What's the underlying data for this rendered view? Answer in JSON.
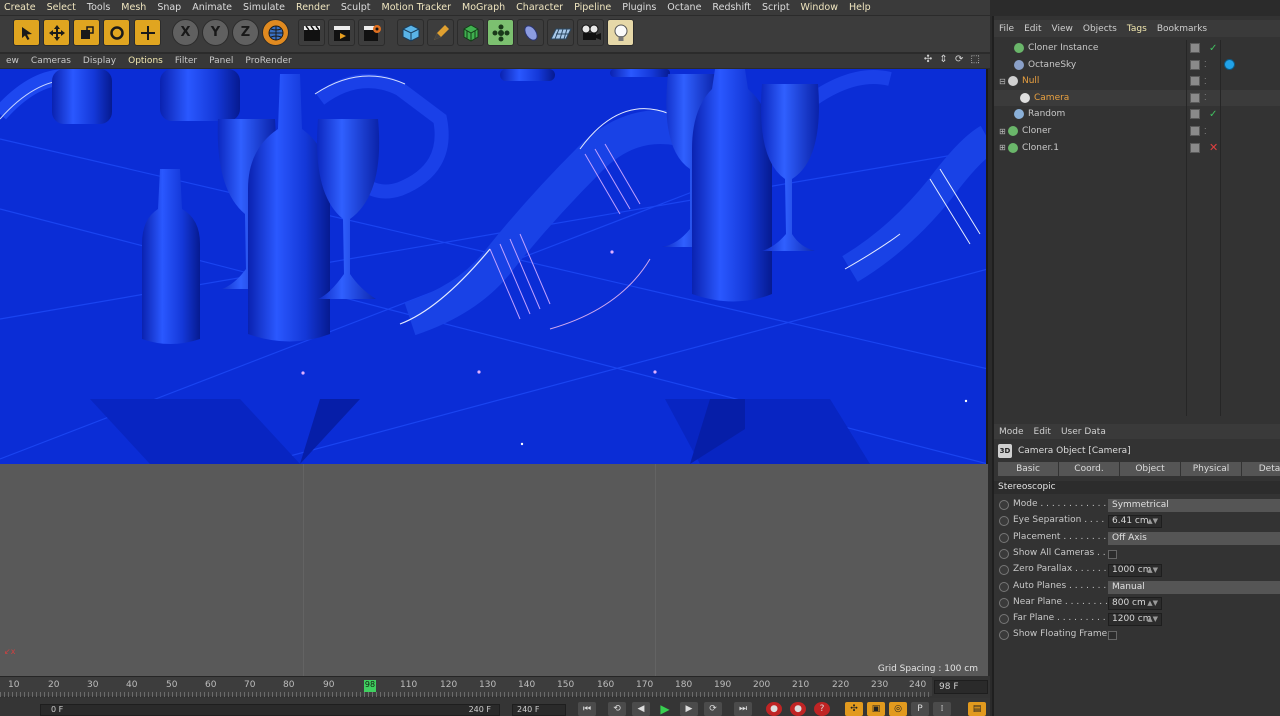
{
  "menubar": {
    "items": [
      "Create",
      "Select",
      "Tools",
      "Mesh",
      "Snap",
      "Animate",
      "Simulate",
      "Render",
      "Sculpt",
      "Motion Tracker",
      "MoGraph",
      "Character",
      "Pipeline",
      "Plugins",
      "Octane",
      "Redshift",
      "Script",
      "Window",
      "Help"
    ]
  },
  "toolbar": {
    "buttons": [
      "select-cursor",
      "move",
      "scale",
      "rotate",
      "recent-add",
      "x-axis",
      "y-axis",
      "z-axis",
      "world-coordinates",
      "render-view",
      "render-picture-viewer",
      "render-settings",
      "cube",
      "pen",
      "subdivision",
      "cloner",
      "deformer",
      "floor",
      "camera",
      "light"
    ],
    "axis_x": "X",
    "axis_y": "Y",
    "axis_z": "Z"
  },
  "viewport_menu": {
    "items": [
      "ew",
      "Cameras",
      "Display",
      "Options",
      "Filter",
      "Panel",
      "ProRender"
    ],
    "hl_item": "Options",
    "nav_icons": "✣ ⇕ ⟳ ⬚"
  },
  "viewport": {
    "grid_label": "Grid Spacing : 100 cm",
    "colors": {
      "scene": "#0b2dd6",
      "floor": "#595959"
    }
  },
  "timeline": {
    "ticks": [
      "10",
      "20",
      "30",
      "40",
      "50",
      "60",
      "70",
      "80",
      "90",
      "98",
      "110",
      "120",
      "130",
      "140",
      "150",
      "160",
      "170",
      "180",
      "190",
      "200",
      "210",
      "220",
      "230",
      "240"
    ],
    "current_frame": "98",
    "current_frame_field": "98 F",
    "start_field": "0 F",
    "end_field": "240 F",
    "end_field_b": "240 F"
  },
  "object_manager": {
    "menu": [
      "File",
      "Edit",
      "View",
      "Objects",
      "Tags",
      "Bookmarks"
    ],
    "menu_highlight": "Tags",
    "objects": [
      {
        "name": "Cloner Instance",
        "icon_color": "#6ab66a",
        "indent": 1,
        "status": "check"
      },
      {
        "name": "OctaneSky",
        "icon_color": "#8aa0c8",
        "indent": 1,
        "status": "dots",
        "tag": true
      },
      {
        "name": "Null",
        "icon_color": "#cfcfcf",
        "indent": 0,
        "status": "dots",
        "orange": true,
        "expand": "⊟"
      },
      {
        "name": "Camera",
        "icon_color": "#e0e0e0",
        "indent": 2,
        "status": "dots",
        "orange": true,
        "selected": true
      },
      {
        "name": "Random",
        "icon_color": "#8ab0d8",
        "indent": 1,
        "status": "check"
      },
      {
        "name": "Cloner",
        "icon_color": "#6ab66a",
        "indent": 0,
        "status": "dots",
        "expand": "⊞"
      },
      {
        "name": "Cloner.1",
        "icon_color": "#6ab66a",
        "indent": 0,
        "status": "cross",
        "expand": "⊞"
      }
    ]
  },
  "attributes": {
    "menu": [
      "Mode",
      "Edit",
      "User Data"
    ],
    "icon_label": "3D",
    "title": "Camera Object [Camera]",
    "tabs": [
      "Basic",
      "Coord.",
      "Object",
      "Physical",
      "Detail"
    ],
    "section": "Stereoscopic",
    "params": [
      {
        "label": "Mode . . . . . . . . . . . . .",
        "type": "drop",
        "value": "Symmetrical"
      },
      {
        "label": "Eye Separation . . . . .",
        "type": "field",
        "value": "6.41 cm"
      },
      {
        "label": "Placement . . . . . . . . .",
        "type": "drop",
        "value": "Off Axis"
      },
      {
        "label": "Show All Cameras . . .",
        "type": "check",
        "value": ""
      },
      {
        "label": "Zero Parallax . . . . . . .",
        "type": "field",
        "value": "1000 cm"
      },
      {
        "label": "Auto Planes . . . . . . . .",
        "type": "drop",
        "value": "Manual"
      },
      {
        "label": "Near Plane . . . . . . . . .",
        "type": "field",
        "value": "800 cm"
      },
      {
        "label": "Far Plane . . . . . . . . . .",
        "type": "field",
        "value": "1200 cm"
      },
      {
        "label": "Show Floating Frame",
        "type": "check",
        "value": ""
      }
    ]
  }
}
